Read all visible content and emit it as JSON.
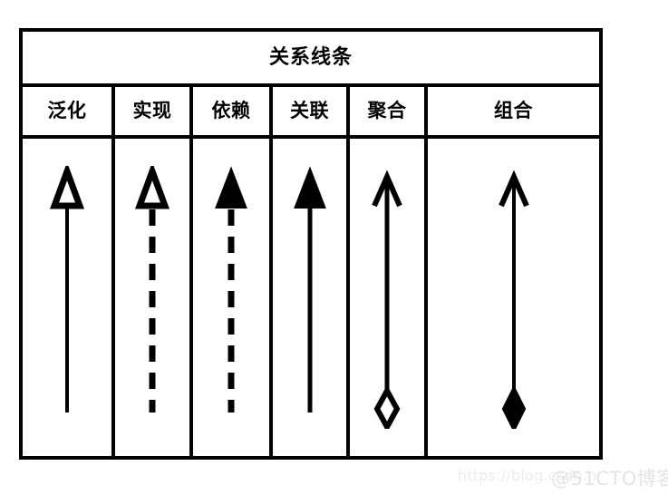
{
  "diagram": {
    "title": "关系线条",
    "columns": [
      {
        "header": "泛化",
        "line_style": "solid",
        "head_symbol": "hollow-triangle",
        "tail_symbol": "none"
      },
      {
        "header": "实现",
        "line_style": "dashed",
        "head_symbol": "hollow-triangle",
        "tail_symbol": "none"
      },
      {
        "header": "依赖",
        "line_style": "dashed",
        "head_symbol": "filled-triangle",
        "tail_symbol": "none"
      },
      {
        "header": "关联",
        "line_style": "solid",
        "head_symbol": "filled-triangle",
        "tail_symbol": "none"
      },
      {
        "header": "聚合",
        "line_style": "solid",
        "head_symbol": "open-arrow",
        "tail_symbol": "hollow-diamond"
      },
      {
        "header": "组合",
        "line_style": "solid",
        "head_symbol": "open-arrow",
        "tail_symbol": "filled-diamond"
      }
    ],
    "colors": {
      "stroke": "#000000",
      "background": "#ffffff",
      "watermark": "#ececec"
    }
  },
  "watermark": {
    "url_text": "https://blog.csdn.n",
    "brand_text": "@51CTO博客"
  }
}
